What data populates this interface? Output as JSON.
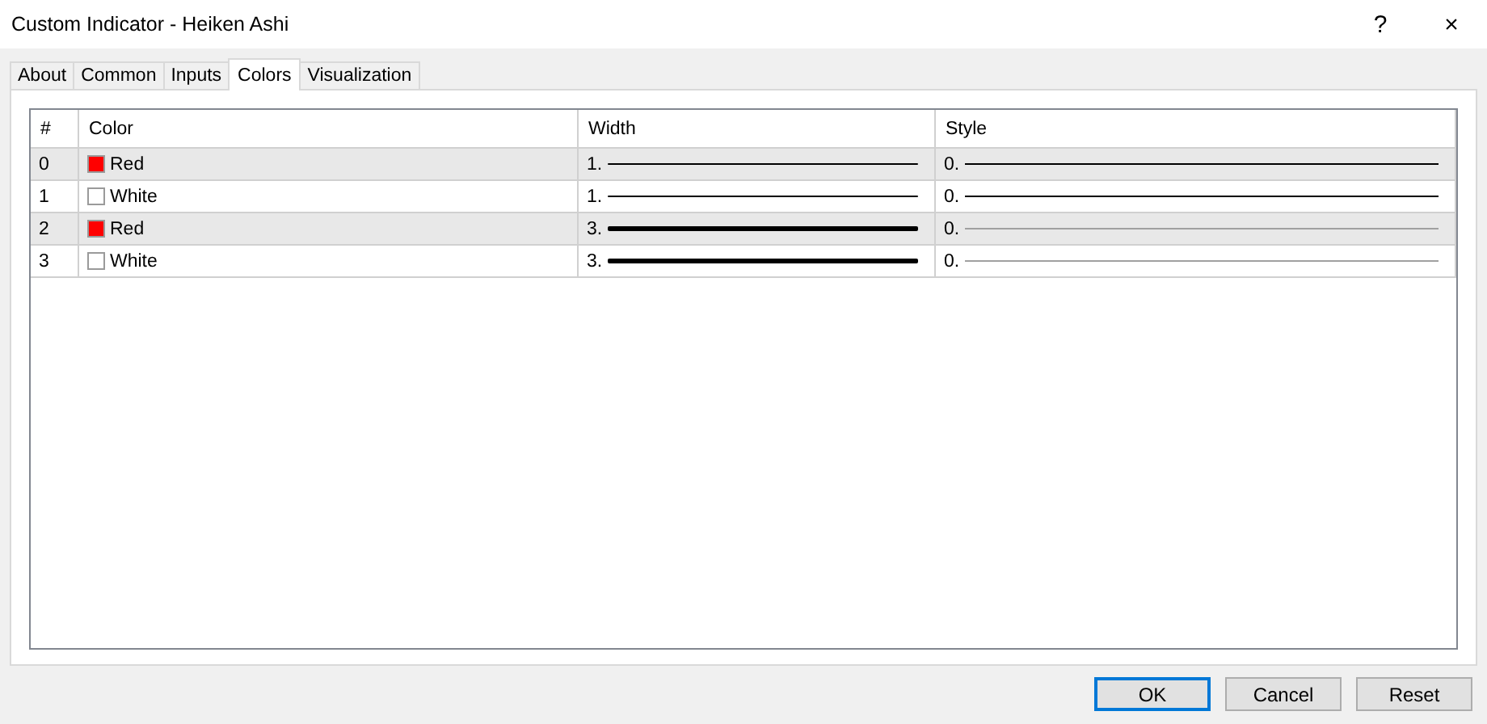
{
  "window": {
    "title": "Custom Indicator - Heiken Ashi",
    "help": "?",
    "close": "×"
  },
  "tabs": [
    {
      "label": "About",
      "selected": false
    },
    {
      "label": "Common",
      "selected": false
    },
    {
      "label": "Inputs",
      "selected": false
    },
    {
      "label": "Colors",
      "selected": true
    },
    {
      "label": "Visualization",
      "selected": false
    }
  ],
  "table": {
    "columns": [
      "#",
      "Color",
      "Width",
      "Style"
    ],
    "rows": [
      {
        "index": "0",
        "color": "#ff0000",
        "color_name": "Red",
        "width": {
          "text": "1.",
          "kind": "thin"
        },
        "style": {
          "text": "0.",
          "kind": "solid"
        }
      },
      {
        "index": "1",
        "color": "#ffffff",
        "color_name": "White",
        "width": {
          "text": "1.",
          "kind": "thin"
        },
        "style": {
          "text": "0.",
          "kind": "solid"
        }
      },
      {
        "index": "2",
        "color": "#ff0000",
        "color_name": "Red",
        "width": {
          "text": "3.",
          "kind": "thick"
        },
        "style": {
          "text": "0.",
          "kind": "faded"
        }
      },
      {
        "index": "3",
        "color": "#ffffff",
        "color_name": "White",
        "width": {
          "text": "3.",
          "kind": "thick"
        },
        "style": {
          "text": "0.",
          "kind": "faded"
        }
      }
    ]
  },
  "buttons": [
    {
      "label": "OK",
      "default": true
    },
    {
      "label": "Cancel",
      "default": false
    },
    {
      "label": "Reset",
      "default": false
    }
  ]
}
